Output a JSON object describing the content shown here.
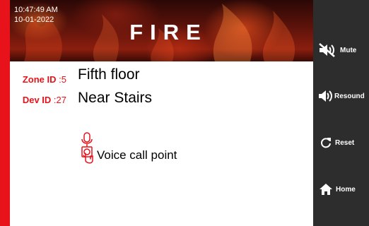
{
  "header": {
    "time": "10:47:49 AM",
    "date": "10-01-2022",
    "title": "FIRE"
  },
  "alarm": {
    "zone_label": "Zone ID",
    "zone_id": ":5",
    "zone_name": "Fifth floor",
    "device_label": "Dev ID",
    "device_id": ":27",
    "device_location": "Near Stairs",
    "device_type": "Voice call point",
    "device_icon": "voice-call-point-icon"
  },
  "sidebar": {
    "items": [
      {
        "label": "Mute",
        "icon": "speaker-muted-icon"
      },
      {
        "label": "Resound",
        "icon": "speaker-sound-icon"
      },
      {
        "label": "Reset",
        "icon": "reset-icon"
      },
      {
        "label": "Home",
        "icon": "home-icon"
      }
    ]
  },
  "colors": {
    "accent": "#e8131a",
    "sidebar": "#2d2d2d",
    "content_bg": "#ffffff"
  }
}
